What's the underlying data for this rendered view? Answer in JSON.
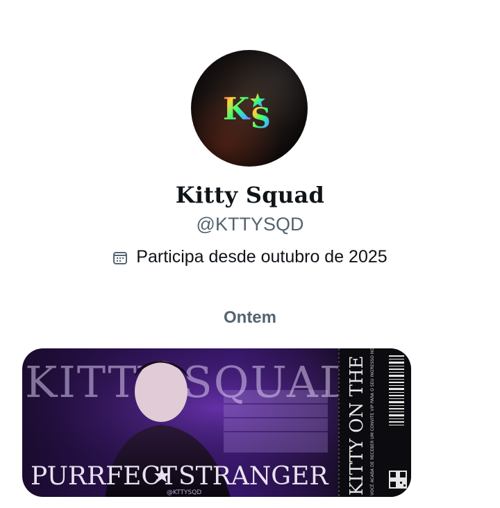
{
  "profile": {
    "name": "Kitty Squad",
    "handle": "@KTTYSQD",
    "joined": "Participa desde outubro de 2025",
    "avatar_text": "K S"
  },
  "date_separator": "Ontem",
  "media": {
    "banner_title": "KITTY SQUAD",
    "bottom_left": "PURRFECT",
    "bottom_right": "STRANGER",
    "watermark": "@KTTYSQD",
    "ticket_vertical": "KITTY ON THE STAGE",
    "ticket_small": "VOCÊ ACABA DE RECEBER UM CONVITE VIP PARA O SEU INGRESSO NO KITTY SQUAD O SQUAD MAIS GATINHO DO X."
  },
  "colors": {
    "text_primary": "#0f1419",
    "text_secondary": "#536471",
    "banner_purple": "#35156a"
  },
  "icons": {
    "calendar": "calendar-icon",
    "star": "star-icon"
  }
}
